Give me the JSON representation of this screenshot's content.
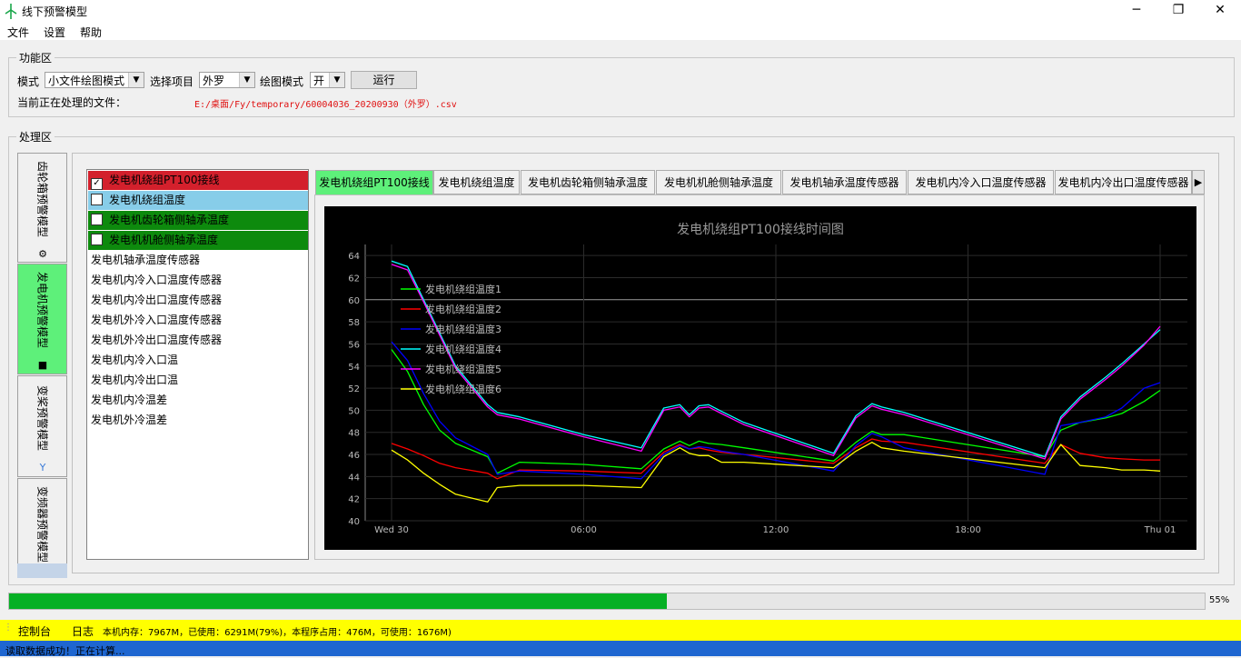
{
  "window": {
    "title": "线下预警模型",
    "minimize": "─",
    "maximize": "❐",
    "close": "✕"
  },
  "menu": [
    "文件",
    "设置",
    "帮助"
  ],
  "function_area": {
    "title": "功能区",
    "mode_label": "模式",
    "mode_value": "小文件绘图模式",
    "project_label": "选择项目",
    "project_value": "外罗",
    "plot_label": "绘图模式",
    "plot_value": "开",
    "run_button": "运行",
    "current_file_label": "当前正在处理的文件：",
    "current_file": "E:/桌面/Fy/temporary/60004036_20200930（外罗）.csv"
  },
  "processing_area": {
    "title": "处理区",
    "vertical_tabs": [
      {
        "label": "齿轮箱预警模型",
        "icon": "gear-icon"
      },
      {
        "label": "发电机预警模型",
        "icon": "generator-icon",
        "active": true
      },
      {
        "label": "变桨预警模型",
        "icon": "pitch-icon"
      },
      {
        "label": "变频器预警模型",
        "icon": "converter-icon"
      }
    ],
    "list_items": [
      {
        "label": "发电机绕组PT100接线",
        "checkbox": true,
        "checked": true,
        "bg": "#d3202c"
      },
      {
        "label": "发电机绕组温度",
        "checkbox": true,
        "checked": false,
        "bg": "#87cde9"
      },
      {
        "label": "发电机齿轮箱侧轴承温度",
        "checkbox": true,
        "checked": false,
        "bg": "#0d8a0d"
      },
      {
        "label": "发电机机舱侧轴承温度",
        "checkbox": true,
        "checked": false,
        "bg": "#0d8a0d"
      },
      {
        "label": "发电机轴承温度传感器",
        "checkbox": false
      },
      {
        "label": "发电机内冷入口温度传感器",
        "checkbox": false
      },
      {
        "label": "发电机内冷出口温度传感器",
        "checkbox": false
      },
      {
        "label": "发电机外冷入口温度传感器",
        "checkbox": false
      },
      {
        "label": "发电机外冷出口温度传感器",
        "checkbox": false
      },
      {
        "label": "发电机内冷入口温",
        "checkbox": false
      },
      {
        "label": "发电机内冷出口温",
        "checkbox": false
      },
      {
        "label": "发电机内冷温差",
        "checkbox": false
      },
      {
        "label": "发电机外冷温差",
        "checkbox": false
      }
    ],
    "tabs": [
      {
        "label": "发电机绕组PT100接线",
        "active": true
      },
      {
        "label": "发电机绕组温度"
      },
      {
        "label": "发电机齿轮箱侧轴承温度"
      },
      {
        "label": "发电机机舱侧轴承温度"
      },
      {
        "label": "发电机轴承温度传感器"
      },
      {
        "label": "发电机内冷入口温度传感器"
      },
      {
        "label": "发电机内冷出口温度传感器"
      }
    ],
    "tab_scroll_arrow": "▶"
  },
  "chart_data": {
    "type": "line",
    "title": "发电机绕组PT100接线时间图",
    "xlabel": "",
    "ylabel": "",
    "x_ticks": [
      "Wed 30",
      "06:00",
      "12:00",
      "18:00",
      "Thu 01"
    ],
    "x_range_hours": [
      0,
      24
    ],
    "ylim": [
      40,
      65
    ],
    "y_ticks": [
      40,
      42,
      44,
      46,
      48,
      50,
      52,
      54,
      56,
      58,
      60,
      62,
      64
    ],
    "grid": true,
    "legend": "upper-left",
    "x": [
      0,
      0.5,
      1,
      1.5,
      2,
      3,
      3.3,
      4,
      6,
      7.8,
      8.5,
      9,
      9.3,
      9.6,
      9.9,
      10.3,
      11,
      13.8,
      14.5,
      15,
      15.3,
      16,
      20.4,
      20.9,
      21.5,
      22.3,
      22.8,
      23.5,
      24
    ],
    "series": [
      {
        "name": "发电机绕组温度1",
        "color": "#00ff00",
        "values": [
          55.5,
          53.5,
          50.5,
          48.2,
          47,
          45.8,
          44.3,
          45.3,
          45.1,
          44.7,
          46.5,
          47.2,
          46.8,
          47.2,
          47.0,
          46.9,
          46.6,
          45.4,
          47.1,
          48.1,
          47.8,
          47.8,
          45.8,
          48.2,
          48.9,
          49.3,
          49.7,
          50.8,
          51.8
        ]
      },
      {
        "name": "发电机绕组温度2",
        "color": "#ff0000",
        "values": [
          47,
          46.5,
          45.9,
          45.2,
          44.8,
          44.3,
          43.8,
          44.6,
          44.5,
          44.3,
          46.2,
          46.9,
          46.5,
          46.6,
          46.4,
          46.2,
          46.0,
          45.2,
          46.6,
          47.4,
          47.2,
          47.1,
          45.2,
          46.9,
          46.1,
          45.7,
          45.6,
          45.5,
          45.5
        ]
      },
      {
        "name": "发电机绕组温度3",
        "color": "#0000ff",
        "values": [
          56.2,
          54.5,
          51.5,
          49,
          47.5,
          46,
          44.2,
          44.5,
          44.2,
          43.8,
          46,
          46.8,
          46.5,
          46.7,
          46.6,
          46.3,
          46.0,
          44.5,
          46.8,
          47.9,
          47.6,
          46.6,
          44.2,
          48.6,
          48.9,
          49.4,
          50.2,
          52.0,
          52.5
        ]
      },
      {
        "name": "发电机绕组温度4",
        "color": "#00ffff",
        "values": [
          63.5,
          63,
          60,
          57,
          54,
          50.5,
          49.8,
          49.4,
          47.8,
          46.6,
          50.2,
          50.5,
          49.6,
          50.4,
          50.5,
          49.9,
          48.9,
          46.1,
          49.5,
          50.6,
          50.3,
          49.8,
          45.8,
          49.4,
          51.2,
          53.0,
          54.2,
          56.0,
          57.3
        ]
      },
      {
        "name": "发电机绕组温度5",
        "color": "#ff00ff",
        "values": [
          63.2,
          62.7,
          59.8,
          56.8,
          53.8,
          50.3,
          49.6,
          49.2,
          47.6,
          46.3,
          50.0,
          50.3,
          49.4,
          50.2,
          50.3,
          49.7,
          48.7,
          45.9,
          49.3,
          50.4,
          50.1,
          49.6,
          45.6,
          49.2,
          51.0,
          52.8,
          54.0,
          55.9,
          57.6
        ]
      },
      {
        "name": "发电机绕组温度6",
        "color": "#ffff00",
        "values": [
          46.4,
          45.5,
          44.3,
          43.3,
          42.4,
          41.7,
          43.0,
          43.2,
          43.2,
          43.0,
          45.8,
          46.6,
          46.1,
          45.9,
          45.9,
          45.3,
          45.3,
          44.8,
          46.3,
          47.1,
          46.6,
          46.3,
          44.8,
          46.9,
          45.0,
          44.8,
          44.6,
          44.6,
          44.5
        ]
      }
    ]
  },
  "progress": {
    "percent": 55,
    "label": "55%"
  },
  "console": {
    "title": "控制台",
    "log_label": "日志",
    "memory_text": "本机内存：7967M，已使用：6291M(79%)，本程序占用：476M，可使用：1676M)"
  },
  "status": {
    "text": "读取数据成功！正在计算..."
  }
}
